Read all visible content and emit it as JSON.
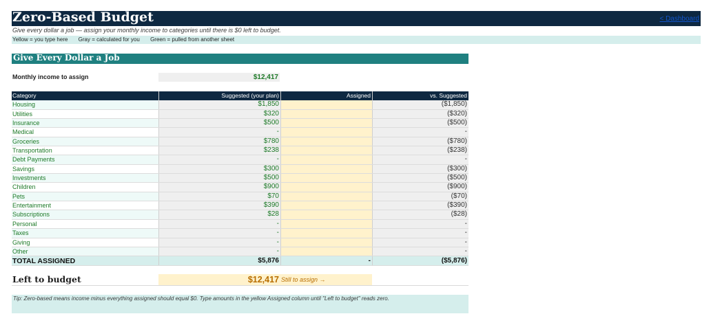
{
  "title": "Zero-Based Budget",
  "dashboard_link": "< Dashboard",
  "subtitle": "Give every dollar a job — assign your monthly income to categories until there is $0 left to budget.",
  "legend": {
    "yellow": "Yellow = you type here",
    "gray": "Gray = calculated for you",
    "green": "Green = pulled from another sheet"
  },
  "section_title": "Give Every Dollar a Job",
  "income": {
    "label": "Monthly income to assign",
    "value": "$12,417"
  },
  "table": {
    "headers": {
      "category": "Category",
      "suggested": "Suggested (your plan)",
      "assigned": "Assigned",
      "vs": "vs. Suggested"
    },
    "rows": [
      {
        "category": "Housing",
        "suggested": "$1,850",
        "assigned": "",
        "vs": "($1,850)"
      },
      {
        "category": "Utilities",
        "suggested": "$320",
        "assigned": "",
        "vs": "($320)"
      },
      {
        "category": "Insurance",
        "suggested": "$500",
        "assigned": "",
        "vs": "($500)"
      },
      {
        "category": "Medical",
        "suggested": "-",
        "assigned": "",
        "vs": "-"
      },
      {
        "category": "Groceries",
        "suggested": "$780",
        "assigned": "",
        "vs": "($780)"
      },
      {
        "category": "Transportation",
        "suggested": "$238",
        "assigned": "",
        "vs": "($238)"
      },
      {
        "category": "Debt Payments",
        "suggested": "-",
        "assigned": "",
        "vs": "-"
      },
      {
        "category": "Savings",
        "suggested": "$300",
        "assigned": "",
        "vs": "($300)"
      },
      {
        "category": "Investments",
        "suggested": "$500",
        "assigned": "",
        "vs": "($500)"
      },
      {
        "category": "Children",
        "suggested": "$900",
        "assigned": "",
        "vs": "($900)"
      },
      {
        "category": "Pets",
        "suggested": "$70",
        "assigned": "",
        "vs": "($70)"
      },
      {
        "category": "Entertainment",
        "suggested": "$390",
        "assigned": "",
        "vs": "($390)"
      },
      {
        "category": "Subscriptions",
        "suggested": "$28",
        "assigned": "",
        "vs": "($28)"
      },
      {
        "category": "Personal",
        "suggested": "-",
        "assigned": "",
        "vs": "-"
      },
      {
        "category": "Taxes",
        "suggested": "-",
        "assigned": "",
        "vs": "-"
      },
      {
        "category": "Giving",
        "suggested": "-",
        "assigned": "",
        "vs": "-"
      },
      {
        "category": "Other",
        "suggested": "-",
        "assigned": "",
        "vs": "-"
      }
    ],
    "total": {
      "label": "TOTAL ASSIGNED",
      "suggested": "$5,876",
      "assigned": "-",
      "vs": "($5,876)"
    }
  },
  "left_to_budget": {
    "label": "Left to budget",
    "value": "$12,417",
    "note": "Still to assign →"
  },
  "tip": "Tip: Zero-based means income minus everything assigned should equal $0. Type amounts in the yellow Assigned column until \"Left to budget\" reads zero."
}
